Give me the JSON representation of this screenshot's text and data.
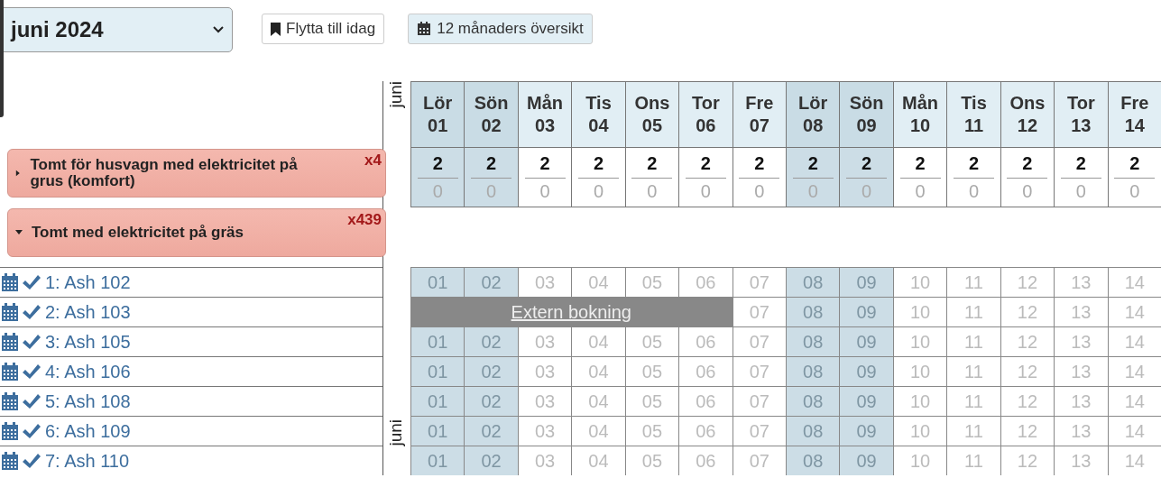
{
  "toolbar": {
    "month_select": {
      "value": "juni 2024"
    },
    "buttons": [
      {
        "kind": "today",
        "label": "Flytta till idag"
      },
      {
        "kind": "overview",
        "label": "12 månaders översikt"
      }
    ]
  },
  "month_labels": [
    "juni",
    "juni"
  ],
  "days": [
    {
      "dow": "Lör",
      "date": "01",
      "weekend": true,
      "available": "2",
      "booked": "0"
    },
    {
      "dow": "Sön",
      "date": "02",
      "weekend": true,
      "available": "2",
      "booked": "0"
    },
    {
      "dow": "Mån",
      "date": "03",
      "weekend": false,
      "available": "2",
      "booked": "0"
    },
    {
      "dow": "Tis",
      "date": "04",
      "weekend": false,
      "available": "2",
      "booked": "0"
    },
    {
      "dow": "Ons",
      "date": "05",
      "weekend": false,
      "available": "2",
      "booked": "0"
    },
    {
      "dow": "Tor",
      "date": "06",
      "weekend": false,
      "available": "2",
      "booked": "0"
    },
    {
      "dow": "Fre",
      "date": "07",
      "weekend": false,
      "available": "2",
      "booked": "0"
    },
    {
      "dow": "Lör",
      "date": "08",
      "weekend": true,
      "available": "2",
      "booked": "0"
    },
    {
      "dow": "Sön",
      "date": "09",
      "weekend": true,
      "available": "2",
      "booked": "0"
    },
    {
      "dow": "Mån",
      "date": "10",
      "weekend": false,
      "available": "2",
      "booked": "0"
    },
    {
      "dow": "Tis",
      "date": "11",
      "weekend": false,
      "available": "2",
      "booked": "0"
    },
    {
      "dow": "Ons",
      "date": "12",
      "weekend": false,
      "available": "2",
      "booked": "0"
    },
    {
      "dow": "Tor",
      "date": "13",
      "weekend": false,
      "available": "2",
      "booked": "0"
    },
    {
      "dow": "Fre",
      "date": "14",
      "weekend": false,
      "available": "2",
      "booked": "0"
    }
  ],
  "groups": [
    {
      "title": "Tomt för husvagn med elektricitet på grus (komfort)",
      "count": "x4",
      "expanded": false
    },
    {
      "title": "Tomt med elektricitet på gräs",
      "count": "x439",
      "expanded": true
    }
  ],
  "units": [
    {
      "label": "1: Ash 102",
      "items": [
        {
          "kind": "day",
          "text": "01"
        },
        {
          "kind": "day",
          "text": "02"
        },
        {
          "kind": "day",
          "text": "03"
        },
        {
          "kind": "day",
          "text": "04"
        },
        {
          "kind": "day",
          "text": "05"
        },
        {
          "kind": "day",
          "text": "06"
        },
        {
          "kind": "day",
          "text": "07"
        },
        {
          "kind": "day",
          "text": "08"
        },
        {
          "kind": "day",
          "text": "09"
        },
        {
          "kind": "day",
          "text": "10"
        },
        {
          "kind": "day",
          "text": "11"
        },
        {
          "kind": "day",
          "text": "12"
        },
        {
          "kind": "day",
          "text": "13"
        },
        {
          "kind": "day",
          "text": "14"
        }
      ]
    },
    {
      "label": "2: Ash 103",
      "items": [
        {
          "kind": "booking",
          "text": "Extern bokning"
        },
        {
          "kind": "day",
          "text": "07"
        },
        {
          "kind": "day",
          "text": "08"
        },
        {
          "kind": "day",
          "text": "09"
        },
        {
          "kind": "day",
          "text": "10"
        },
        {
          "kind": "day",
          "text": "11"
        },
        {
          "kind": "day",
          "text": "12"
        },
        {
          "kind": "day",
          "text": "13"
        },
        {
          "kind": "day",
          "text": "14"
        }
      ]
    },
    {
      "label": "3: Ash 105",
      "items": [
        {
          "kind": "day",
          "text": "01"
        },
        {
          "kind": "day",
          "text": "02"
        },
        {
          "kind": "day",
          "text": "03"
        },
        {
          "kind": "day",
          "text": "04"
        },
        {
          "kind": "day",
          "text": "05"
        },
        {
          "kind": "day",
          "text": "06"
        },
        {
          "kind": "day",
          "text": "07"
        },
        {
          "kind": "day",
          "text": "08"
        },
        {
          "kind": "day",
          "text": "09"
        },
        {
          "kind": "day",
          "text": "10"
        },
        {
          "kind": "day",
          "text": "11"
        },
        {
          "kind": "day",
          "text": "12"
        },
        {
          "kind": "day",
          "text": "13"
        },
        {
          "kind": "day",
          "text": "14"
        }
      ]
    },
    {
      "label": "4: Ash 106",
      "items": [
        {
          "kind": "day",
          "text": "01"
        },
        {
          "kind": "day",
          "text": "02"
        },
        {
          "kind": "day",
          "text": "03"
        },
        {
          "kind": "day",
          "text": "04"
        },
        {
          "kind": "day",
          "text": "05"
        },
        {
          "kind": "day",
          "text": "06"
        },
        {
          "kind": "day",
          "text": "07"
        },
        {
          "kind": "day",
          "text": "08"
        },
        {
          "kind": "day",
          "text": "09"
        },
        {
          "kind": "day",
          "text": "10"
        },
        {
          "kind": "day",
          "text": "11"
        },
        {
          "kind": "day",
          "text": "12"
        },
        {
          "kind": "day",
          "text": "13"
        },
        {
          "kind": "day",
          "text": "14"
        }
      ]
    },
    {
      "label": "5: Ash 108",
      "items": [
        {
          "kind": "day",
          "text": "01"
        },
        {
          "kind": "day",
          "text": "02"
        },
        {
          "kind": "day",
          "text": "03"
        },
        {
          "kind": "day",
          "text": "04"
        },
        {
          "kind": "day",
          "text": "05"
        },
        {
          "kind": "day",
          "text": "06"
        },
        {
          "kind": "day",
          "text": "07"
        },
        {
          "kind": "day",
          "text": "08"
        },
        {
          "kind": "day",
          "text": "09"
        },
        {
          "kind": "day",
          "text": "10"
        },
        {
          "kind": "day",
          "text": "11"
        },
        {
          "kind": "day",
          "text": "12"
        },
        {
          "kind": "day",
          "text": "13"
        },
        {
          "kind": "day",
          "text": "14"
        }
      ]
    },
    {
      "label": "6: Ash 109",
      "items": [
        {
          "kind": "day",
          "text": "01"
        },
        {
          "kind": "day",
          "text": "02"
        },
        {
          "kind": "day",
          "text": "03"
        },
        {
          "kind": "day",
          "text": "04"
        },
        {
          "kind": "day",
          "text": "05"
        },
        {
          "kind": "day",
          "text": "06"
        },
        {
          "kind": "day",
          "text": "07"
        },
        {
          "kind": "day",
          "text": "08"
        },
        {
          "kind": "day",
          "text": "09"
        },
        {
          "kind": "day",
          "text": "10"
        },
        {
          "kind": "day",
          "text": "11"
        },
        {
          "kind": "day",
          "text": "12"
        },
        {
          "kind": "day",
          "text": "13"
        },
        {
          "kind": "day",
          "text": "14"
        }
      ]
    },
    {
      "label": "7: Ash 110",
      "items": [
        {
          "kind": "day",
          "text": "01"
        },
        {
          "kind": "day",
          "text": "02"
        },
        {
          "kind": "day",
          "text": "03"
        },
        {
          "kind": "day",
          "text": "04"
        },
        {
          "kind": "day",
          "text": "05"
        },
        {
          "kind": "day",
          "text": "06"
        },
        {
          "kind": "day",
          "text": "07"
        },
        {
          "kind": "day",
          "text": "08"
        },
        {
          "kind": "day",
          "text": "09"
        },
        {
          "kind": "day",
          "text": "10"
        },
        {
          "kind": "day",
          "text": "11"
        },
        {
          "kind": "day",
          "text": "12"
        },
        {
          "kind": "day",
          "text": "13"
        },
        {
          "kind": "day",
          "text": "14"
        }
      ]
    }
  ]
}
